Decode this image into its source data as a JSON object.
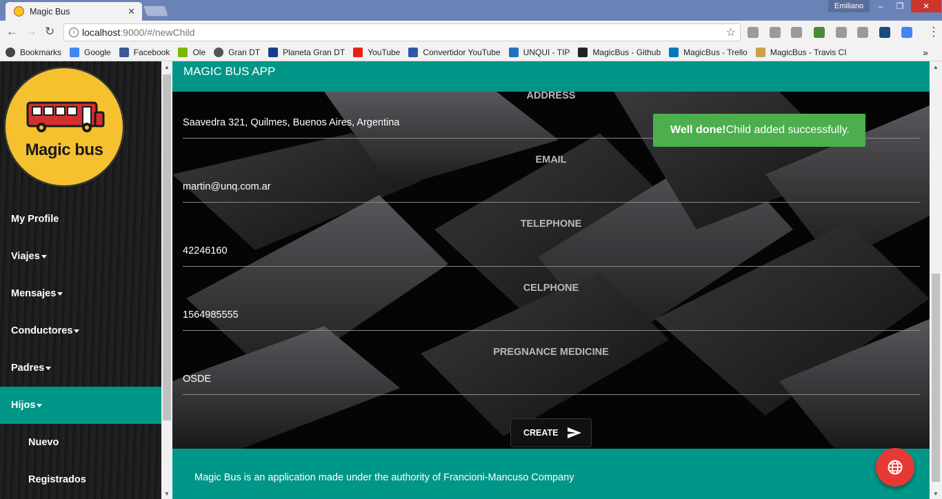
{
  "browser": {
    "tab_title": "Magic Bus",
    "tab_close": "✕",
    "user": "Emiliano",
    "url_host": "localhost",
    "url_path": ":9000/#/newChild",
    "bookmarks": [
      {
        "label": "Bookmarks",
        "icon": "star-icon",
        "color": "#444444"
      },
      {
        "label": "Google",
        "icon": "google-icon",
        "color": "#4285f4"
      },
      {
        "label": "Facebook",
        "icon": "facebook-icon",
        "color": "#3b5998"
      },
      {
        "label": "Ole",
        "icon": "ole-icon",
        "color": "#7ab800"
      },
      {
        "label": "Gran DT",
        "icon": "globe-icon",
        "color": "#555555"
      },
      {
        "label": "Planeta Gran DT",
        "icon": "dt-icon",
        "color": "#1a3c8c"
      },
      {
        "label": "YouTube",
        "icon": "youtube-icon",
        "color": "#e62117"
      },
      {
        "label": "Convertidor YouTube",
        "icon": "mp3-icon",
        "color": "#3355aa"
      },
      {
        "label": "UNQUI - TIP",
        "icon": "wiki-icon",
        "color": "#1e73be"
      },
      {
        "label": "MagicBus - Github",
        "icon": "github-icon",
        "color": "#222222"
      },
      {
        "label": "MagicBus - Trello",
        "icon": "trello-icon",
        "color": "#0079bf"
      },
      {
        "label": "MagicBus - Travis CI",
        "icon": "travis-icon",
        "color": "#c8a24a"
      }
    ],
    "more_bookmarks": "»"
  },
  "sidebar": {
    "logo_text": "Magic bus",
    "items": [
      {
        "label": "My Profile",
        "caret": false,
        "active": false
      },
      {
        "label": "Viajes",
        "caret": true,
        "active": false
      },
      {
        "label": "Mensajes",
        "caret": true,
        "active": false
      },
      {
        "label": "Conductores",
        "caret": true,
        "active": false
      },
      {
        "label": "Padres",
        "caret": true,
        "active": false
      },
      {
        "label": "Hijos",
        "caret": true,
        "active": true
      }
    ],
    "subitems": [
      "Nuevo",
      "Registrados"
    ]
  },
  "header": {
    "title": "MAGIC BUS APP"
  },
  "form": {
    "fields": [
      {
        "label": "ADDRESS",
        "value": "Saavedra 321, Quilmes, Buenos Aires, Argentina"
      },
      {
        "label": "EMAIL",
        "value": "martin@unq.com.ar"
      },
      {
        "label": "TELEPHONE",
        "value": "42246160"
      },
      {
        "label": "CELPHONE",
        "value": "1564985555"
      },
      {
        "label": "PREGNANCE MEDICINE",
        "value": "OSDE"
      }
    ],
    "create_label": "CREATE"
  },
  "toast": {
    "strong": "Well done!",
    "message": "Child added successfully."
  },
  "footer": {
    "text": "Magic Bus is an application made under the authority of Francioni-Mancuso Company"
  },
  "colors": {
    "accent": "#009688",
    "toast": "#4cae4c",
    "fab": "#e53935"
  }
}
